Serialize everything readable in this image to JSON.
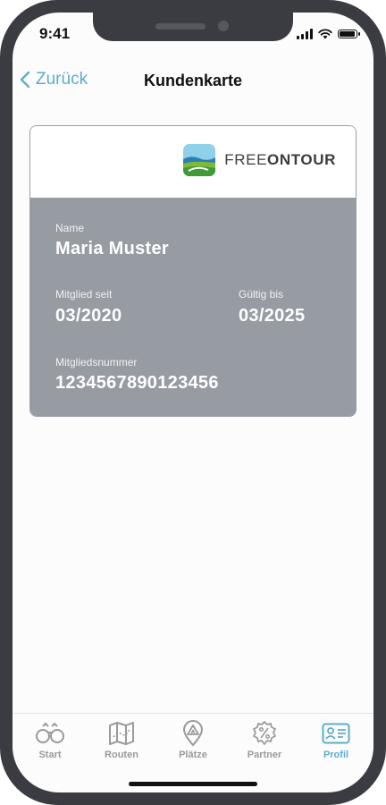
{
  "status": {
    "time": "9:41"
  },
  "nav": {
    "back_label": "Zurück",
    "title": "Kundenkarte"
  },
  "card": {
    "brand": {
      "part1": "FREE",
      "part2": "ONTOUR"
    },
    "name_label": "Name",
    "name_value": "Maria Muster",
    "since_label": "Mitglied seit",
    "since_value": "03/2020",
    "valid_label": "Gültig bis",
    "valid_value": "03/2025",
    "number_label": "Mitgliedsnummer",
    "number_value": "1234567890123456"
  },
  "tabs": [
    {
      "label": "Start",
      "icon": "binoculars-icon"
    },
    {
      "label": "Routen",
      "icon": "map-icon"
    },
    {
      "label": "Plätze",
      "icon": "campsite-icon"
    },
    {
      "label": "Partner",
      "icon": "percent-badge-icon"
    },
    {
      "label": "Profil",
      "icon": "id-card-icon",
      "active": true
    }
  ],
  "colors": {
    "accent": "#5aaecb",
    "card_body": "#979ca3",
    "frame": "#3b3c41"
  }
}
